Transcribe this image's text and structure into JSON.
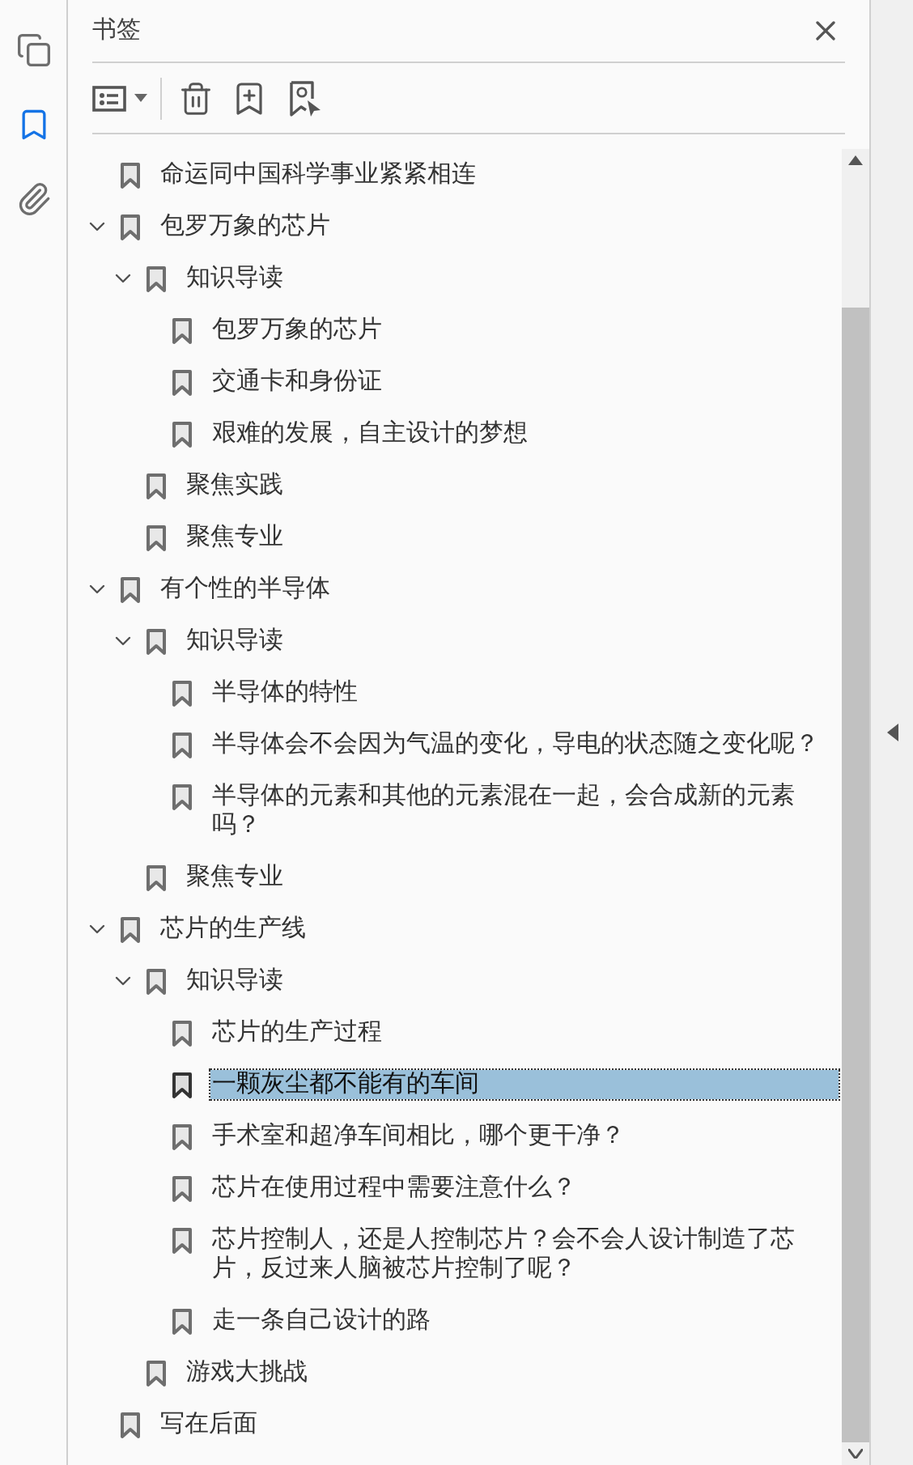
{
  "panel": {
    "title": "书签"
  },
  "rail": [
    {
      "kind": "pages",
      "selected": false
    },
    {
      "kind": "bookmarks",
      "selected": true
    },
    {
      "kind": "attachments",
      "selected": false
    }
  ],
  "bookmarks": [
    {
      "label": "命运同中国科学事业紧紧相连",
      "selected": false
    },
    {
      "label": "包罗万象的芯片",
      "selected": false,
      "expanded": true,
      "children": [
        {
          "label": "知识导读",
          "selected": false,
          "expanded": true,
          "children": [
            {
              "label": "包罗万象的芯片",
              "selected": false
            },
            {
              "label": "交通卡和身份证",
              "selected": false
            },
            {
              "label": "艰难的发展，自主设计的梦想",
              "selected": false
            }
          ]
        },
        {
          "label": "聚焦实践",
          "selected": false
        },
        {
          "label": "聚焦专业",
          "selected": false
        }
      ]
    },
    {
      "label": "有个性的半导体",
      "selected": false,
      "expanded": true,
      "children": [
        {
          "label": "知识导读",
          "selected": false,
          "expanded": true,
          "children": [
            {
              "label": "半导体的特性",
              "selected": false
            },
            {
              "label": "半导体会不会因为气温的变化，导电的状态随之变化呢？",
              "selected": false
            },
            {
              "label": "半导体的元素和其他的元素混在一起，会合成新的元素吗？",
              "selected": false
            }
          ]
        },
        {
          "label": "聚焦专业",
          "selected": false
        }
      ]
    },
    {
      "label": "芯片的生产线",
      "selected": false,
      "expanded": true,
      "children": [
        {
          "label": "知识导读",
          "selected": false,
          "expanded": true,
          "children": [
            {
              "label": "芯片的生产过程",
              "selected": false
            },
            {
              "label": "一颗灰尘都不能有的车间",
              "selected": true
            },
            {
              "label": "手术室和超净车间相比，哪个更干净？",
              "selected": false
            },
            {
              "label": "芯片在使用过程中需要注意什么？",
              "selected": false
            },
            {
              "label": "芯片控制人，还是人控制芯片？会不会人设计制造了芯片，反过来人脑被芯片控制了呢？",
              "selected": false
            },
            {
              "label": "走一条自己设计的路",
              "selected": false
            }
          ]
        },
        {
          "label": "游戏大挑战",
          "selected": false
        }
      ]
    },
    {
      "label": "写在后面",
      "selected": false
    }
  ]
}
